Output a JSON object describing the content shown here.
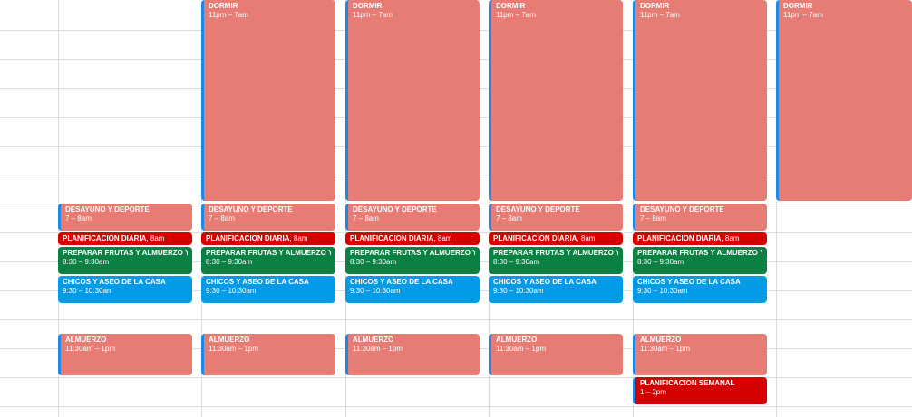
{
  "colors": {
    "flamingo": "#e67c73",
    "tomato": "#d50000",
    "basil": "#0b8043",
    "peacock": "#039be5",
    "accent": "#1e88e5",
    "grid": "#dadce0"
  },
  "days": [
    {
      "name": "day-1",
      "events": [
        {
          "type": "desayuno",
          "title": "DESAYUNO Y DEPORTE",
          "time": "7 – 8am"
        },
        {
          "type": "planificacion",
          "title": "PLANIFICACION DIARIA",
          "time": "8am"
        },
        {
          "type": "preparar",
          "title": "PREPARAR FRUTAS Y ALMUERZO Y TAREAS",
          "time": "8:30 – 9:30am"
        },
        {
          "type": "chicos",
          "title": "CHICOS Y ASEO DE LA CASA",
          "time": "9:30 – 10:30am"
        },
        {
          "type": "almuerzo",
          "title": "ALMUERZO",
          "time": "11:30am – 1pm"
        }
      ]
    },
    {
      "name": "day-2",
      "events": [
        {
          "type": "dormir",
          "title": "DORMIR",
          "time": "11pm – 7am"
        },
        {
          "type": "desayuno",
          "title": "DESAYUNO Y DEPORTE",
          "time": "7 – 8am"
        },
        {
          "type": "planificacion",
          "title": "PLANIFICACION DIARIA",
          "time": "8am"
        },
        {
          "type": "preparar",
          "title": "PREPARAR FRUTAS Y ALMUERZO Y TAREAS",
          "time": "8:30 – 9:30am"
        },
        {
          "type": "chicos",
          "title": "CHICOS Y ASEO DE LA CASA",
          "time": "9:30 – 10:30am"
        },
        {
          "type": "almuerzo",
          "title": "ALMUERZO",
          "time": "11:30am – 1pm"
        }
      ]
    },
    {
      "name": "day-3",
      "events": [
        {
          "type": "dormir",
          "title": "DORMIR",
          "time": "11pm – 7am"
        },
        {
          "type": "desayuno",
          "title": "DESAYUNO Y DEPORTE",
          "time": "7 – 8am"
        },
        {
          "type": "planificacion",
          "title": "PLANIFICACION DIARIA",
          "time": "8am"
        },
        {
          "type": "preparar",
          "title": "PREPARAR FRUTAS Y ALMUERZO Y TAREAS",
          "time": "8:30 – 9:30am"
        },
        {
          "type": "chicos",
          "title": "CHICOS Y ASEO DE LA CASA",
          "time": "9:30 – 10:30am"
        },
        {
          "type": "almuerzo",
          "title": "ALMUERZO",
          "time": "11:30am – 1pm"
        }
      ]
    },
    {
      "name": "day-4",
      "events": [
        {
          "type": "dormir",
          "title": "DORMIR",
          "time": "11pm – 7am"
        },
        {
          "type": "desayuno",
          "title": "DESAYUNO Y DEPORTE",
          "time": "7 – 8am"
        },
        {
          "type": "planificacion",
          "title": "PLANIFICACION DIARIA",
          "time": "8am"
        },
        {
          "type": "preparar",
          "title": "PREPARAR FRUTAS Y ALMUERZO Y TAREAS",
          "time": "8:30 – 9:30am"
        },
        {
          "type": "chicos",
          "title": "CHICOS Y ASEO DE LA CASA",
          "time": "9:30 – 10:30am"
        },
        {
          "type": "almuerzo",
          "title": "ALMUERZO",
          "time": "11:30am – 1pm"
        }
      ]
    },
    {
      "name": "day-5",
      "events": [
        {
          "type": "dormir",
          "title": "DORMIR",
          "time": "11pm – 7am"
        },
        {
          "type": "desayuno",
          "title": "DESAYUNO Y DEPORTE",
          "time": "7 – 8am"
        },
        {
          "type": "planificacion",
          "title": "PLANIFICACION DIARIA",
          "time": "8am"
        },
        {
          "type": "preparar",
          "title": "PREPARAR FRUTAS Y ALMUERZO Y TAREAS",
          "time": "8:30 – 9:30am"
        },
        {
          "type": "chicos",
          "title": "CHICOS Y ASEO DE LA CASA",
          "time": "9:30 – 10:30am"
        },
        {
          "type": "almuerzo",
          "title": "ALMUERZO",
          "time": "11:30am – 1pm"
        },
        {
          "type": "semanal",
          "title": "PLANIFICACION SEMANAL",
          "time": "1 – 2pm"
        }
      ]
    },
    {
      "name": "day-6",
      "events": [
        {
          "type": "dormir",
          "title": "DORMIR",
          "time": "11pm – 7am"
        }
      ]
    }
  ]
}
